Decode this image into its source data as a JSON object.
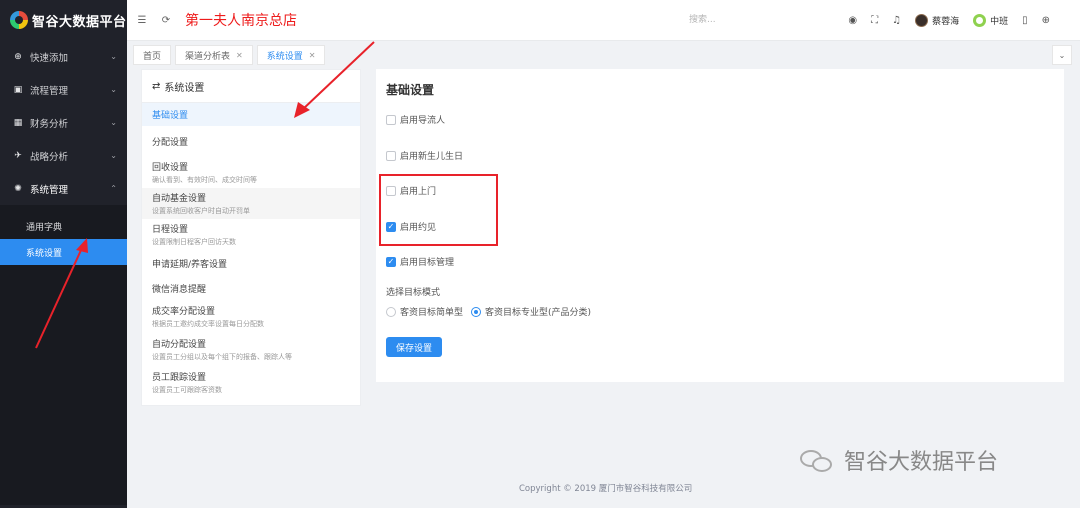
{
  "app": {
    "title": "智谷大数据平台"
  },
  "sidebar": {
    "items": [
      {
        "label": "快速添加",
        "icon": "plus-circle-icon",
        "glyph": "⊕"
      },
      {
        "label": "流程管理",
        "icon": "camera-icon",
        "glyph": "▣"
      },
      {
        "label": "财务分析",
        "icon": "chart-icon",
        "glyph": "▦"
      },
      {
        "label": "战略分析",
        "icon": "plane-icon",
        "glyph": "✈"
      },
      {
        "label": "系统管理",
        "icon": "gear-icon",
        "glyph": "✺"
      }
    ],
    "sub_items": [
      {
        "label": "通用字典"
      },
      {
        "label": "系统设置"
      }
    ]
  },
  "header": {
    "store_name": "第一夫人南京总店",
    "search_placeholder": "搜索...",
    "user1": "蔡蓉海",
    "user2": "中班"
  },
  "tabs": [
    {
      "label": "首页"
    },
    {
      "label": "渠道分析表"
    },
    {
      "label": "系统设置"
    }
  ],
  "settings_list": {
    "title": "系统设置",
    "items": [
      {
        "title": "基础设置",
        "desc": ""
      },
      {
        "title": "分配设置",
        "desc": ""
      },
      {
        "title": "回收设置",
        "desc": "确认看到、有效时间、成交时间等"
      },
      {
        "title": "自动基金设置",
        "desc": "设置系统回收客户时自动开罚单"
      },
      {
        "title": "日程设置",
        "desc": "设置限制日程客户回访天数"
      },
      {
        "title": "申请延期/养客设置",
        "desc": ""
      },
      {
        "title": "微信消息提醒",
        "desc": ""
      },
      {
        "title": "成交率分配设置",
        "desc": "根据员工邀约成交率设置每日分配数"
      },
      {
        "title": "自动分配设置",
        "desc": "设置员工分组以及每个组下的报备、跟踪人等"
      },
      {
        "title": "员工跟踪设置",
        "desc": "设置员工可跟踪客资数"
      }
    ]
  },
  "main": {
    "title": "基础设置",
    "checkboxes": [
      {
        "label": "启用导流人",
        "checked": false
      },
      {
        "label": "启用新生儿生日",
        "checked": false
      },
      {
        "label": "启用上门",
        "checked": false
      },
      {
        "label": "启用约见",
        "checked": true
      },
      {
        "label": "启用目标管理",
        "checked": true
      }
    ],
    "mode_label": "选择目标模式",
    "radios": [
      {
        "label": "客资目标简单型",
        "selected": false
      },
      {
        "label": "客资目标专业型(产品分类)",
        "selected": true
      }
    ],
    "save_label": "保存设置"
  },
  "footer": {
    "copyright": "Copyright © 2019 厦门市智谷科技有限公司"
  },
  "watermark": {
    "text": "智谷大数据平台"
  },
  "colors": {
    "accent": "#2d8cf0",
    "sidebar_bg": "#20222a",
    "annotation_red": "#e8222a",
    "store_red": "#ee1c1c"
  }
}
